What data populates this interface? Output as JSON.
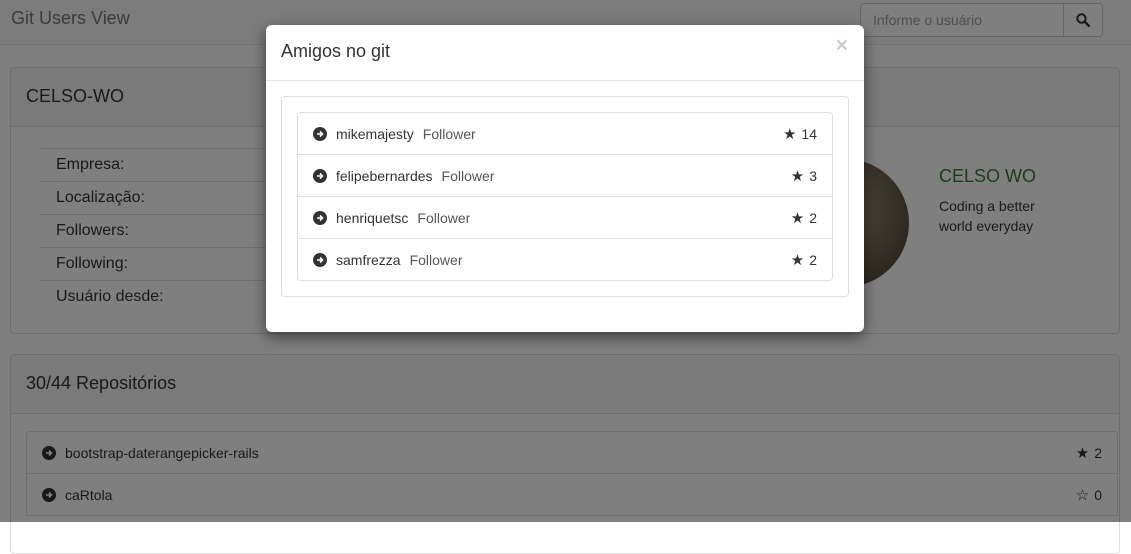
{
  "navbar": {
    "brand": "Git Users View",
    "search_placeholder": "Informe o usuário"
  },
  "profile": {
    "username": "CELSO-WO",
    "fields": [
      "Empresa:",
      "Localização:",
      "Followers:",
      "Following:",
      "Usuário desde:"
    ],
    "display_name": "CELSO WO",
    "bio": "Coding a better world everyday"
  },
  "repositories": {
    "title": "30/44 Repositórios",
    "items": [
      {
        "name": "bootstrap-daterangepicker-rails",
        "stars": "2",
        "star_style": "filled"
      },
      {
        "name": "caRtola",
        "stars": "0",
        "star_style": "empty"
      }
    ]
  },
  "modal": {
    "title": "Amigos no git",
    "close_label": "×",
    "friends": [
      {
        "login": "mikemajesty",
        "relation": "Follower",
        "stars": "14"
      },
      {
        "login": "felipebernardes",
        "relation": "Follower",
        "stars": "3"
      },
      {
        "login": "henriquetsc",
        "relation": "Follower",
        "stars": "2"
      },
      {
        "login": "samfrezza",
        "relation": "Follower",
        "stars": "2"
      }
    ]
  },
  "icons": {
    "search": "search-icon",
    "arrow": "circle-arrow-right-icon",
    "star": "star-icon"
  },
  "colors": {
    "accent_green": "#3c763d",
    "backdrop": "rgba(0,0,0,0.5)"
  }
}
